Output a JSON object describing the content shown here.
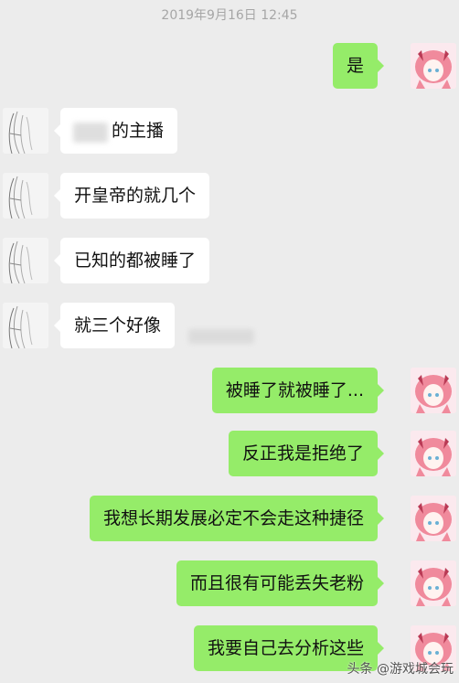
{
  "timestamp": "2019年9月16日 12:45",
  "messages": [
    {
      "side": "right",
      "text": "是"
    },
    {
      "side": "left",
      "text": "的主播"
    },
    {
      "side": "left",
      "text": "开皇帝的就几个"
    },
    {
      "side": "left",
      "text": "已知的都被睡了"
    },
    {
      "side": "left",
      "text": "就三个好像"
    },
    {
      "side": "right",
      "text": "被睡了就被睡了..."
    },
    {
      "side": "right",
      "text": "反正我是拒绝了"
    },
    {
      "side": "right",
      "text": "我想长期发展必定不会走这种捷径"
    },
    {
      "side": "right",
      "text": "而且很有可能丢失老粉"
    },
    {
      "side": "right",
      "text": "我要自己去分析这些"
    }
  ],
  "watermark": "头条 @游戏城会玩",
  "colors": {
    "background": "#ececec",
    "self_bubble": "#95ec69",
    "other_bubble": "#ffffff",
    "timestamp_text": "#a6a6a6"
  },
  "icons": {
    "self_avatar": "anime-avatar-pink-hair",
    "other_avatar": "anime-avatar-sketch"
  }
}
